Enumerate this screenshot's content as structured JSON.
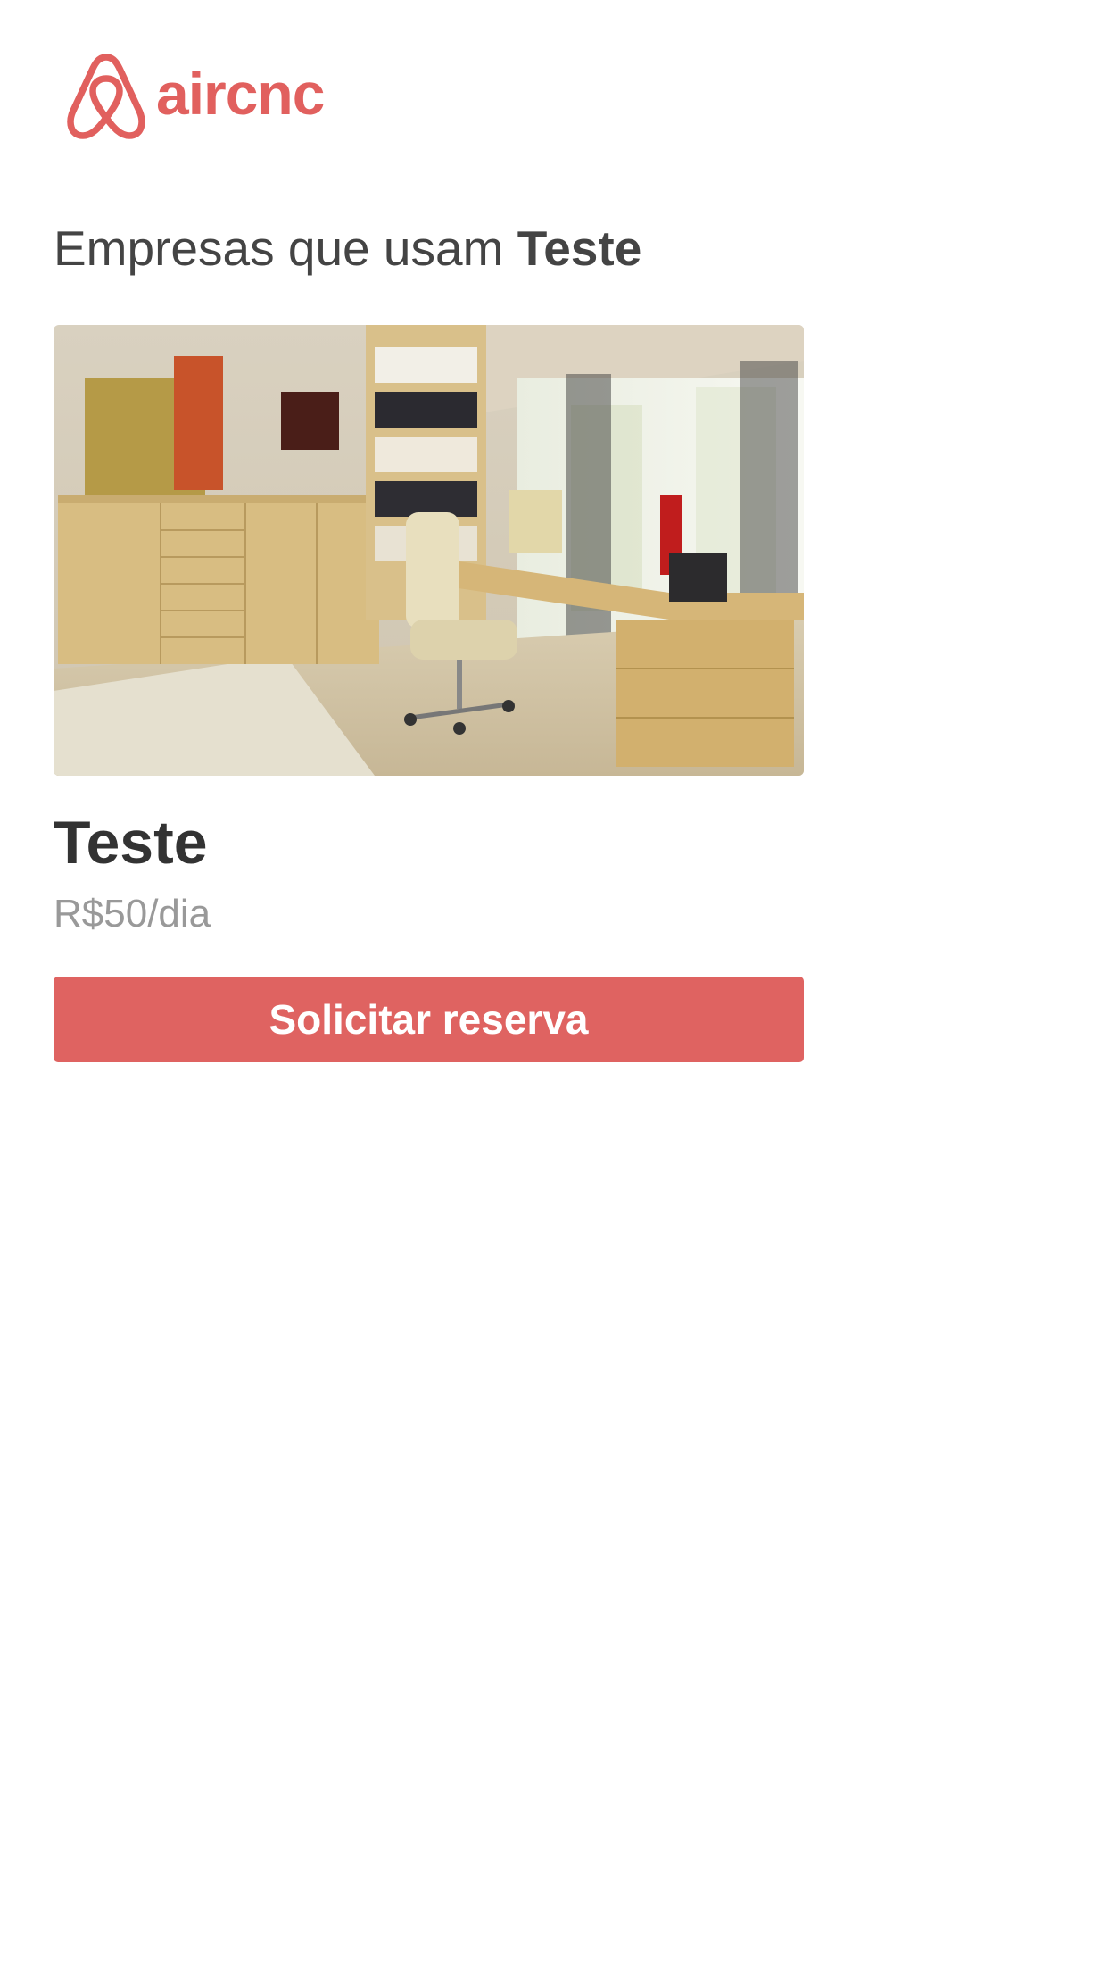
{
  "brand": {
    "name": "aircnc",
    "logo_icon": "airbnb-belo-icon",
    "color": "#E1605E"
  },
  "heading": {
    "prefix": "Empresas que usam",
    "tech": "Teste"
  },
  "spots": [
    {
      "company": "Teste",
      "price": "R$50/dia",
      "thumbnail_icon": "office-photo",
      "action_label": "Solicitar reserva",
      "action_color": "#DF6361"
    }
  ]
}
